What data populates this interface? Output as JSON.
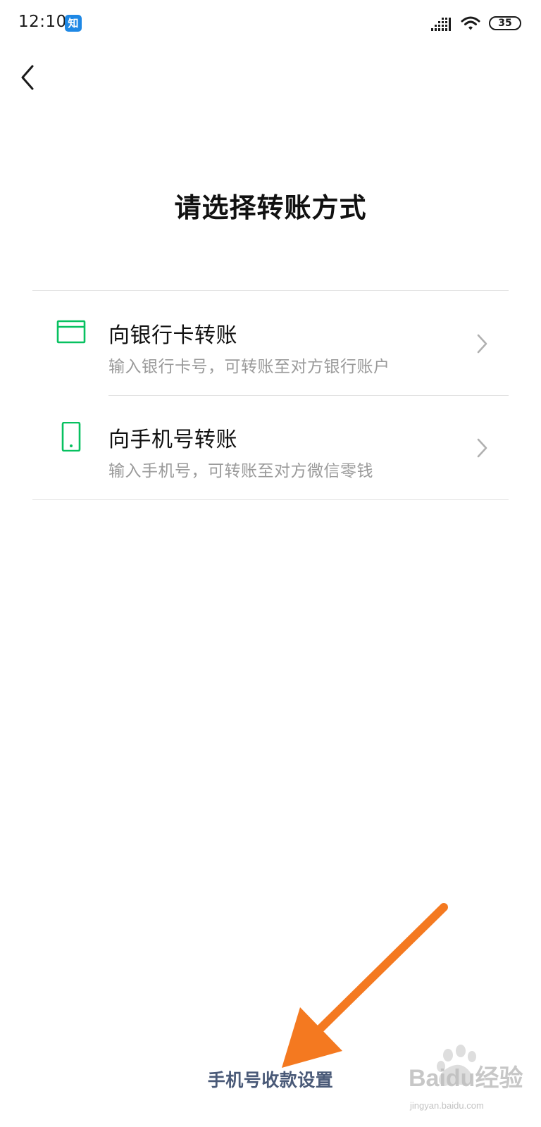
{
  "status_bar": {
    "time": "12:10",
    "app_notification": "知",
    "battery": "35"
  },
  "nav": {
    "back_icon": "chevron-left-icon"
  },
  "page": {
    "title": "请选择转账方式"
  },
  "options": [
    {
      "icon": "bank-card-icon",
      "title": "向银行卡转账",
      "subtitle": "输入银行卡号，可转账至对方银行账户"
    },
    {
      "icon": "mobile-phone-icon",
      "title": "向手机号转账",
      "subtitle": "输入手机号，可转账至对方微信零钱"
    }
  ],
  "footer": {
    "link": "手机号收款设置"
  },
  "watermark": {
    "brand": "Baidu经验",
    "url": "jingyan.baidu.com"
  },
  "colors": {
    "accent": "#07c160",
    "link": "#4a5a78",
    "annotation_arrow": "#f47920"
  }
}
